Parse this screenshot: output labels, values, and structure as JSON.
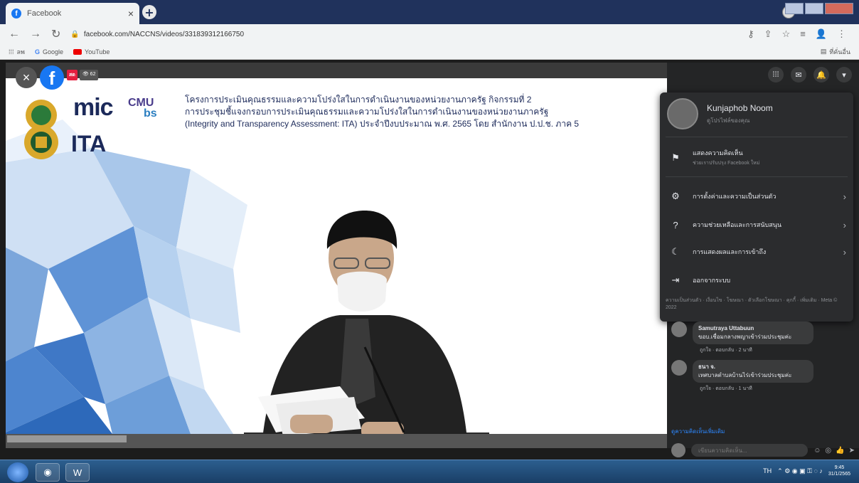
{
  "browser": {
    "tab_title": "Facebook",
    "url": "facebook.com/NACCNS/videos/331839312166750",
    "bookmarks": [
      {
        "label": "ลพ"
      },
      {
        "label": "Google"
      },
      {
        "label": "YouTube"
      }
    ],
    "bookmarks_right": "ที่คั่นอื่น"
  },
  "video": {
    "live_label": "สด",
    "viewer_count": "62",
    "logos": {
      "mic": "mic",
      "ita": "ITA",
      "cmu": "CMU",
      "bs": "bs"
    },
    "header_lines": [
      "โครงการประเมินคุณธรรมและความโปร่งใสในการดำเนินงานของหน่วยงานภาครัฐ กิจกรรมที่ 2",
      "การประชุมชี้แจงกรอบการประเมินคุณธรรมและความโปร่งใสในการดำเนินงานของหน่วยงานภาครัฐ",
      "(Integrity and Transparency Assessment: ITA) ประจำปีงบประมาณ พ.ศ. 2565 โดย สำนักงาน ป.ป.ช. ภาค 5"
    ]
  },
  "menu": {
    "profile_name": "Kunjaphob Noom",
    "profile_sub": "ดูโปรไฟล์ของคุณ",
    "feedback_label": "แสดงความคิดเห็น",
    "feedback_sub": "ช่วยเราปรับปรุง Facebook ใหม่",
    "items": [
      {
        "label": "การตั้งค่าและความเป็นส่วนตัว"
      },
      {
        "label": "ความช่วยเหลือและการสนับสนุน"
      },
      {
        "label": "การแสดงผลและการเข้าถึง"
      },
      {
        "label": "ออกจากระบบ"
      }
    ],
    "footer": "ความเป็นส่วนตัว · เงื่อนไข · โฆษณา · ตัวเลือกโฆษณา · คุกกี้ · เพิ่มเติม · Meta © 2022"
  },
  "comments": [
    {
      "name": "Samutraya Uttabuun",
      "text": "ขอบ.เชื่อมกลางพญาเข้าร่วมประชุมค่ะ",
      "meta": "ถูกใจ · ตอบกลับ · 2 นาที"
    },
    {
      "name": "ธนา จ.",
      "text": "เทศบาลตำบลบ้านไร่เข้าร่วมประชุมค่ะ",
      "meta": "ถูกใจ · ตอบกลับ · 1 นาที"
    }
  ],
  "see_more": "ดูความคิดเห็นเพิ่มเติม",
  "comment_placeholder": "เขียนความคิดเห็น...",
  "taskbar": {
    "lang": "TH",
    "time": "9:45",
    "date": "31/1/2565"
  }
}
